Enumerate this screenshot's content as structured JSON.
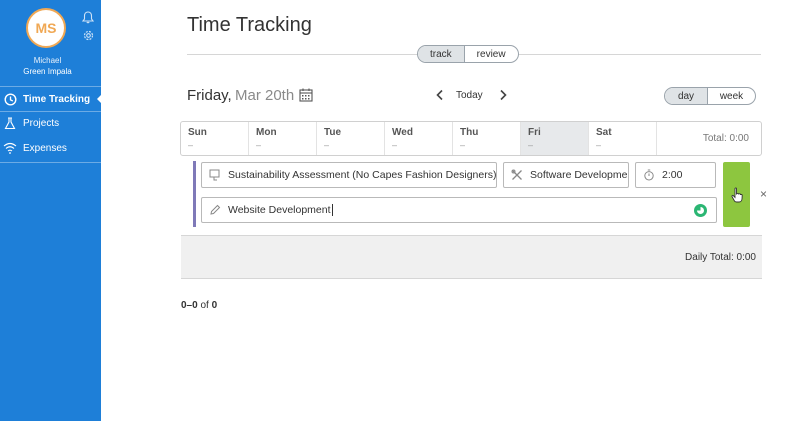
{
  "sidebar": {
    "avatar_initials": "MS",
    "user_first": "Michael",
    "user_last": "Green Impala",
    "items": [
      {
        "label": "Time Tracking",
        "icon": "clock-icon",
        "active": true
      },
      {
        "label": "Projects",
        "icon": "flask-icon",
        "active": false
      },
      {
        "label": "Expenses",
        "icon": "wifi-icon",
        "active": false
      }
    ],
    "accent": "#1e7fd8"
  },
  "header": {
    "title": "Time Tracking",
    "mode_tabs": [
      "track",
      "review"
    ],
    "active_mode": "track"
  },
  "date_nav": {
    "day": "Friday,",
    "date": "Mar 20th",
    "today_label": "Today",
    "range_tabs": [
      "day",
      "week"
    ],
    "active_range": "day"
  },
  "week": {
    "days": [
      {
        "label": "Sun",
        "value": "–"
      },
      {
        "label": "Mon",
        "value": "–"
      },
      {
        "label": "Tue",
        "value": "–"
      },
      {
        "label": "Wed",
        "value": "–"
      },
      {
        "label": "Thu",
        "value": "–"
      },
      {
        "label": "Fri",
        "value": "–"
      },
      {
        "label": "Sat",
        "value": "–"
      }
    ],
    "selected_day": "Fri",
    "total": "Total: 0:00"
  },
  "entry": {
    "project": "Sustainability Assessment (No Capes Fashion Designers)",
    "task": "Software Developme",
    "time": "2:00",
    "note": "Website Development",
    "save_color": "#8dc63f",
    "close_glyph": "×"
  },
  "daily_total": "Daily Total: 0:00",
  "pagination": {
    "range": "0–0",
    "of": "of",
    "total": "0"
  }
}
